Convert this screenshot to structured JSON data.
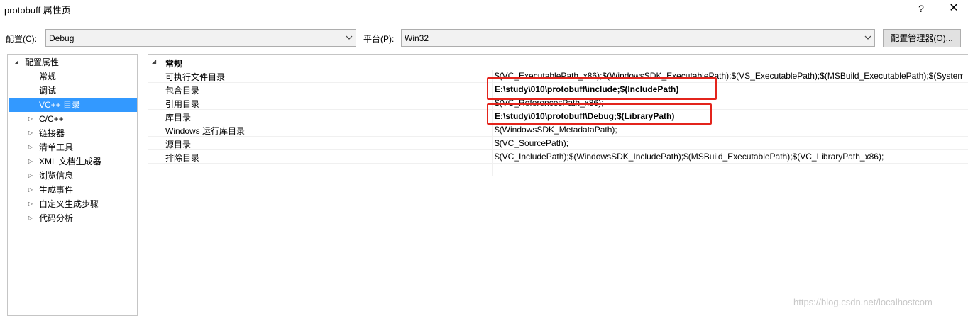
{
  "window": {
    "title": "protobuff 属性页",
    "help": "?",
    "close": "✕"
  },
  "toolbar": {
    "config_label": "配置(C):",
    "config_value": "Debug",
    "platform_label": "平台(P):",
    "platform_value": "Win32",
    "manager_button": "配置管理器(O)..."
  },
  "tree": {
    "items": [
      {
        "label": "配置属性",
        "expander": "◢"
      },
      {
        "label": "常规",
        "expander": ""
      },
      {
        "label": "调试",
        "expander": ""
      },
      {
        "label": "VC++ 目录",
        "expander": "",
        "selected": true
      },
      {
        "label": "C/C++",
        "expander": "▷"
      },
      {
        "label": "链接器",
        "expander": "▷"
      },
      {
        "label": "清单工具",
        "expander": "▷"
      },
      {
        "label": "XML 文档生成器",
        "expander": "▷"
      },
      {
        "label": "浏览信息",
        "expander": "▷"
      },
      {
        "label": "生成事件",
        "expander": "▷"
      },
      {
        "label": "自定义生成步骤",
        "expander": "▷"
      },
      {
        "label": "代码分析",
        "expander": "▷"
      }
    ]
  },
  "grid": {
    "section_label": "常规",
    "section_expander": "◢",
    "rows": [
      {
        "name": "可执行文件目录",
        "value": "$(VC_ExecutablePath_x86);$(WindowsSDK_ExecutablePath);$(VS_ExecutablePath);$(MSBuild_ExecutablePath);$(SystemRoot)"
      },
      {
        "name": "包含目录",
        "value": "E:\\study\\010\\protobuff\\include;$(IncludePath)",
        "bold": true
      },
      {
        "name": "引用目录",
        "value": "$(VC_ReferencesPath_x86);"
      },
      {
        "name": "库目录",
        "value": "E:\\study\\010\\protobuff\\Debug;$(LibraryPath)",
        "bold": true
      },
      {
        "name": "Windows 运行库目录",
        "value": "$(WindowsSDK_MetadataPath);"
      },
      {
        "name": "源目录",
        "value": "$(VC_SourcePath);"
      },
      {
        "name": "排除目录",
        "value": "$(VC_IncludePath);$(WindowsSDK_IncludePath);$(MSBuild_ExecutablePath);$(VC_LibraryPath_x86);"
      }
    ]
  },
  "watermark": "https://blog.csdn.net/localhostcom",
  "colors": {
    "selection": "#3399ff",
    "highlight_box": "#e3241c"
  }
}
